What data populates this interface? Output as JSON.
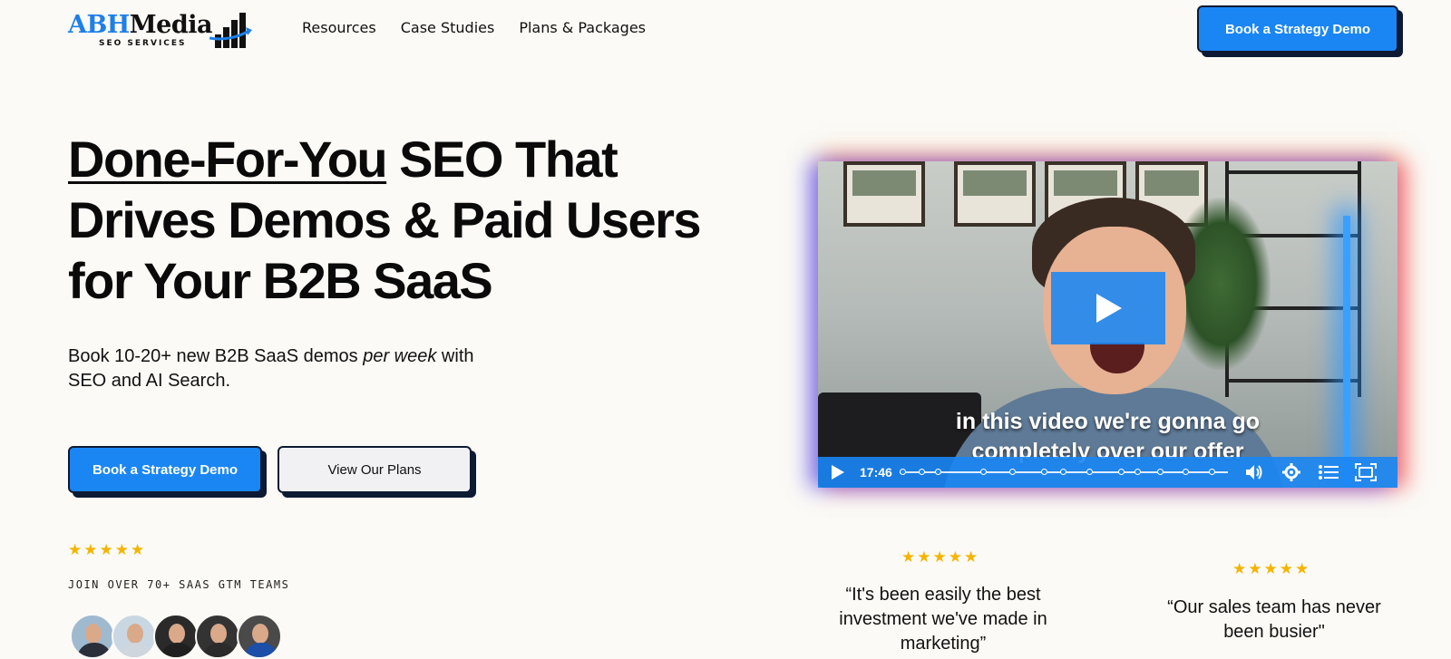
{
  "brand": {
    "name_part1": "ABH",
    "name_part2": "Media",
    "tagline": "SEO SERVICES",
    "accent_color": "#1a86f4"
  },
  "nav": {
    "items": [
      {
        "label": "Resources"
      },
      {
        "label": "Case Studies"
      },
      {
        "label": "Plans & Packages"
      }
    ],
    "cta_label": "Book a Strategy Demo"
  },
  "hero": {
    "title_underlined": "Done-For-You",
    "title_rest_line1": " SEO That",
    "title_line2": "Drives Demos & Paid Users",
    "title_line3": "for Your B2B SaaS",
    "subtitle_before": "Book 10-20+ new B2B SaaS demos ",
    "subtitle_emphasis": "per week",
    "subtitle_after": " with SEO and AI Search.",
    "primary_cta": "Book a Strategy Demo",
    "secondary_cta": "View Our Plans",
    "rating_stars": "★★★★★",
    "rating_value": 5,
    "social_proof": "JOIN OVER 70+ SAAS GTM TEAMS",
    "avatars": [
      {
        "name": "avatar-1",
        "shirt": "#2a2f3a"
      },
      {
        "name": "avatar-2",
        "shirt": "#cfd6dd"
      },
      {
        "name": "avatar-3",
        "shirt": "#1f1f1f"
      },
      {
        "name": "avatar-4",
        "shirt": "#2b2b2b"
      },
      {
        "name": "avatar-5",
        "shirt": "#1b4fa8"
      }
    ]
  },
  "video": {
    "caption_line1": "in this video we're gonna go",
    "caption_line2": "completely over our offer",
    "time": "17:46",
    "icons": [
      "play-icon",
      "volume-icon",
      "settings-icon",
      "chapters-icon",
      "fullscreen-icon"
    ]
  },
  "testimonials": [
    {
      "stars": "★★★★★",
      "rating": 5,
      "quote": "“It's been easily the best investment we've made in marketing”"
    },
    {
      "stars": "★★★★★",
      "rating": 5,
      "quote": "“Our sales team has never been busier\""
    }
  ]
}
